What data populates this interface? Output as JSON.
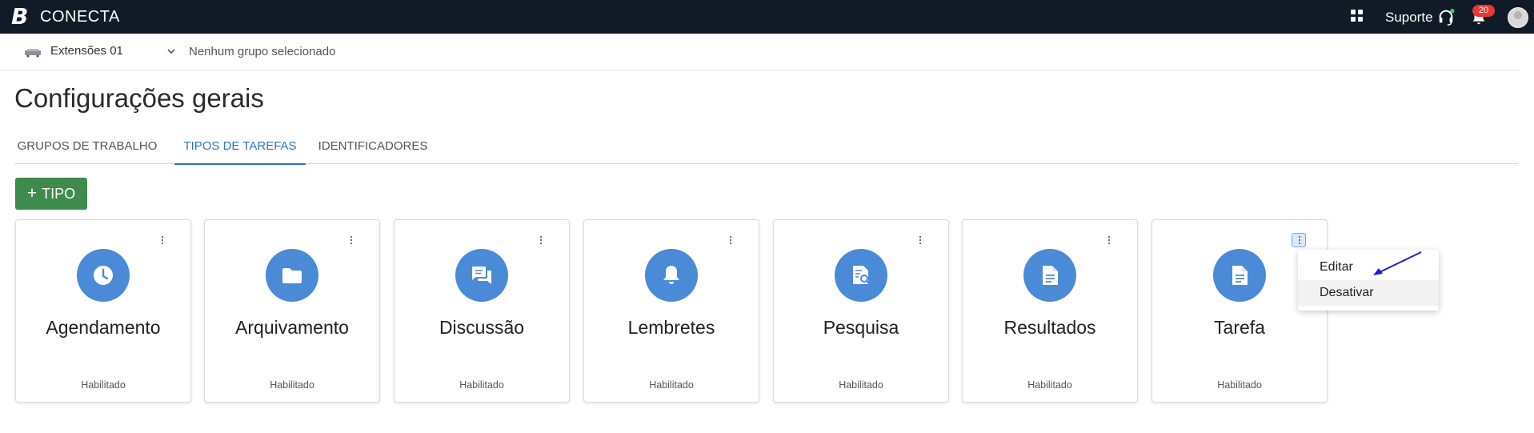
{
  "topbar": {
    "logo": "B",
    "app_name": "CONECTA",
    "support_label": "Suporte",
    "notification_count": "20"
  },
  "subheader": {
    "extension_label": "Extensões 01",
    "group_label": "Nenhum grupo selecionado"
  },
  "page": {
    "title": "Configurações gerais"
  },
  "tabs": [
    {
      "label": "GRUPOS DE TRABALHO",
      "active": false
    },
    {
      "label": "TIPOS DE TAREFAS",
      "active": true
    },
    {
      "label": "IDENTIFICADORES",
      "active": false
    }
  ],
  "add_button": {
    "plus": "+",
    "label": "TIPO"
  },
  "cards": [
    {
      "title": "Agendamento",
      "status": "Habilitado",
      "icon": "clock-icon"
    },
    {
      "title": "Arquivamento",
      "status": "Habilitado",
      "icon": "folder-icon"
    },
    {
      "title": "Discussão",
      "status": "Habilitado",
      "icon": "chat-icon"
    },
    {
      "title": "Lembretes",
      "status": "Habilitado",
      "icon": "bell-icon"
    },
    {
      "title": "Pesquisa",
      "status": "Habilitado",
      "icon": "search-document-icon"
    },
    {
      "title": "Resultados",
      "status": "Habilitado",
      "icon": "document-icon"
    },
    {
      "title": "Tarefa",
      "status": "Habilitado",
      "icon": "document-icon"
    }
  ],
  "context_menu": {
    "items": [
      "Editar",
      "Desativar"
    ]
  },
  "colors": {
    "topbar_bg": "#111a27",
    "accent": "#2d74c9",
    "add_button_bg": "#3f8a4d",
    "card_icon_bg": "#4a8ad6",
    "badge_bg": "#e53935",
    "arrow": "#1a1ad0"
  }
}
